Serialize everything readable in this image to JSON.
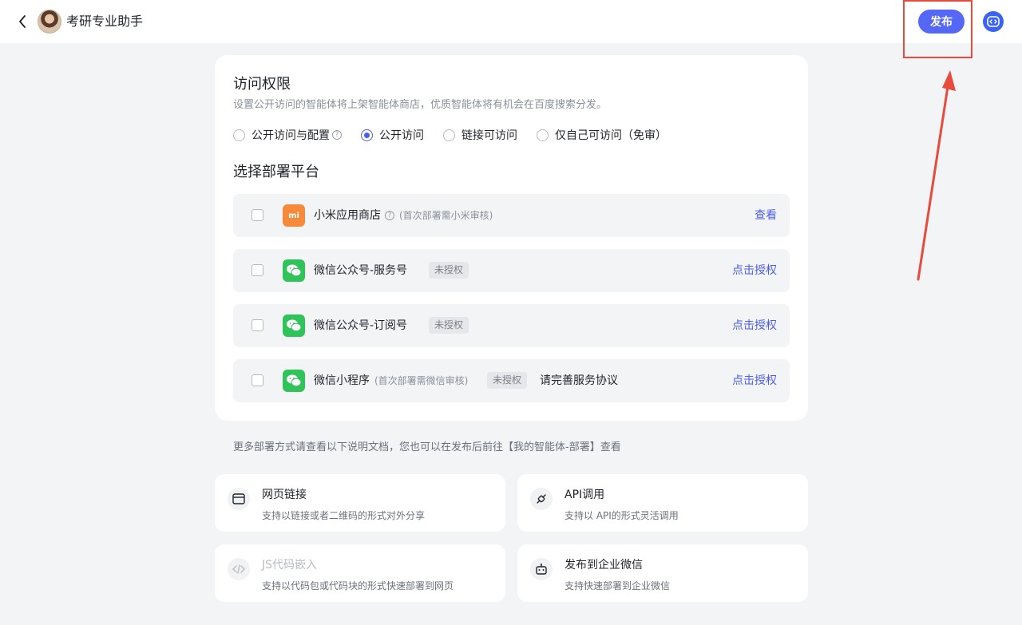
{
  "header": {
    "app_name": "考研专业助手",
    "publish_label": "发布"
  },
  "access": {
    "title": "访问权限",
    "desc": "设置公开访问的智能体将上架智能体商店，优质智能体将有机会在百度搜索分发。",
    "options": [
      {
        "label": "公开访问与配置",
        "checked": false,
        "help": true
      },
      {
        "label": "公开访问",
        "checked": true
      },
      {
        "label": "链接可访问",
        "checked": false
      },
      {
        "label": "仅自己可访问（免审）",
        "checked": false
      }
    ]
  },
  "platforms": {
    "title": "选择部署平台",
    "items": [
      {
        "name": "小米应用商店",
        "note": "(首次部署需小米审核)",
        "icon": "xiaomi-icon",
        "action": "查看"
      },
      {
        "name": "微信公众号-服务号",
        "badge": "未授权",
        "icon": "wechat-icon",
        "action": "点击授权"
      },
      {
        "name": "微信公众号-订阅号",
        "badge": "未授权",
        "icon": "wechat-icon",
        "action": "点击授权"
      },
      {
        "name": "微信小程序",
        "note": "(首次部署需微信审核)",
        "badge": "未授权",
        "extra": "请完善服务协议",
        "icon": "wechat-icon",
        "action": "点击授权"
      }
    ]
  },
  "more_text": "更多部署方式请查看以下说明文档，您也可以在发布后前往【我的智能体-部署】查看",
  "deploy_options": [
    {
      "title": "网页链接",
      "desc": "支持以链接或者二维码的形式对外分享",
      "icon": "webpage-icon"
    },
    {
      "title": "API调用",
      "desc": "支持以 API的形式灵活调用",
      "icon": "api-plug-icon"
    },
    {
      "title": "JS代码嵌入",
      "desc": "支持以代码包或代码块的形式快速部署到网页",
      "icon": "code-icon",
      "disabled": true
    },
    {
      "title": "发布到企业微信",
      "desc": "支持快速部署到企业微信",
      "icon": "robot-icon"
    }
  ],
  "mi_text": "mi",
  "colors": {
    "accent": "#4c5cf0",
    "publish": "#5468f5",
    "highlight": "#e84a3c",
    "wechat": "#30c35a",
    "xiaomi": "#f7893a"
  }
}
